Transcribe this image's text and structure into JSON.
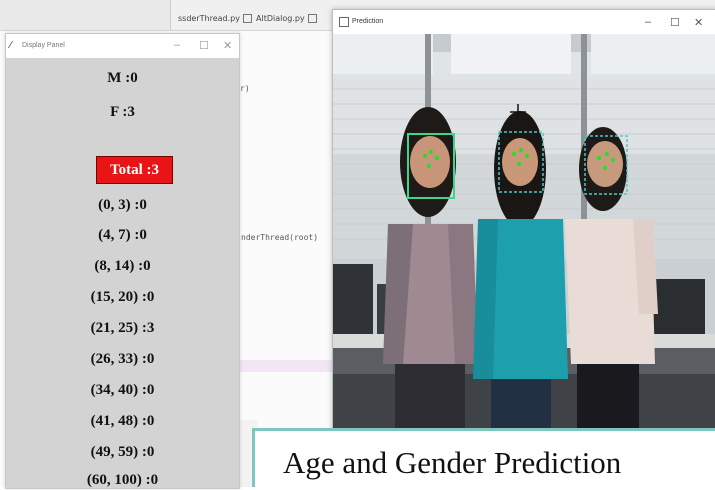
{
  "ide": {
    "tabs": [
      "ssderThread.py",
      "AltDialog.py"
    ],
    "code_fragment_1": "r)",
    "code_fragment_2": "nderThread(root)",
    "code_fragment_3": "1."
  },
  "display_panel": {
    "title": "Display Panel",
    "stats": [
      {
        "label": "M :0"
      },
      {
        "label": "F :3"
      }
    ],
    "total": "Total :3",
    "age_groups": [
      "(0, 3) :0",
      "(4, 7) :0",
      "(8, 14) :0",
      "(15, 20) :0",
      "(21, 25) :3",
      "(26, 33) :0",
      "(34, 40) :0",
      "(41, 48) :0",
      "(49, 59) :0",
      "(60, 100) :0"
    ],
    "total_color": "#e81416"
  },
  "prediction_window": {
    "title": "Prediction",
    "face_box_color": "#3dd68c",
    "landmark_color": "#22e022"
  },
  "slide": {
    "title": "Age and Gender Prediction"
  },
  "window_controls": {
    "minimize": "–",
    "maximize": "☐",
    "close": "✕"
  }
}
